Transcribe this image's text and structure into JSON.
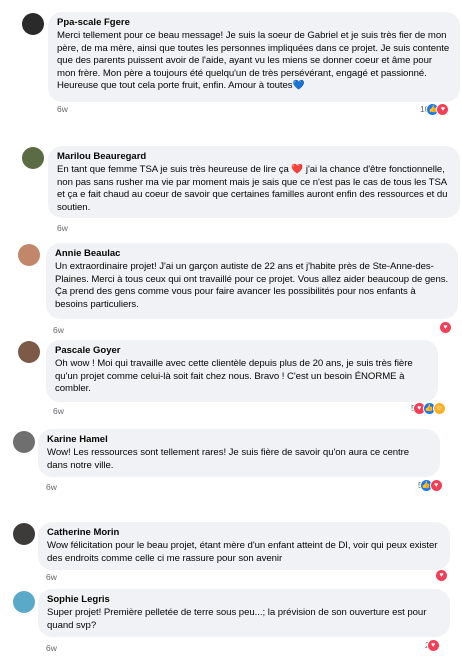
{
  "comments": [
    {
      "author": "Ppa-scale Fgere",
      "text": "Merci tellement pour ce beau message! Je suis la soeur de Gabriel et je suis très fier de mon père, de ma mère, ainsi que toutes les personnes impliquées dans ce projet. Je suis contente que des parents puissent avoir de l'aide, ayant vu les miens se donner coeur et âme pour mon frère. Mon père a toujours été quelqu'un de très persévérant, engagé et passionné. Heureuse que tout cela porte fruit, enfin. Amour à toutes💙",
      "time": "6w",
      "reaction_count": "10",
      "reactions": [
        "like-icon",
        "love-icon"
      ]
    },
    {
      "author": "Marilou Beauregard",
      "text": "En tant que femme TSA je suis très heureuse de lire ça ❤️ j'ai la chance d'être fonctionnelle, non pas sans rusher ma vie par moment mais je sais que ce n'est pas le cas de tous les TSA et ça e fait chaud au coeur de savoir que certaines familles auront enfin des ressources et du soutien.",
      "time": "6w",
      "reaction_count": "",
      "reactions": []
    },
    {
      "author": "Annie Beaulac",
      "text": "Un extraordinaire projet! J'ai un garçon autiste de 22 ans et j'habite près de Ste-Anne-des-Plaines. Merci à tous ceux qui ont travaillé pour ce projet. Vous allez aider beaucoup de gens. Ça prend des gens comme vous pour faire avancer les possibilités pour nos enfants à besoins particuliers.",
      "time": "6w",
      "reaction_count": "",
      "reactions": [
        "love-icon"
      ]
    },
    {
      "author": "Pascale Goyer",
      "text": "Oh wow ! Moi qui travaille avec cette clientèle depuis plus de 20 ans, je suis très fière qu'un projet comme celui-là soit fait chez nous. Bravo ! C'est un besoin ÉNORME à combler.",
      "time": "6w",
      "reaction_count": "5",
      "reactions": [
        "love-icon",
        "like-icon",
        "care-icon"
      ]
    },
    {
      "author": "Karine Hamel",
      "text": "Wow! Les ressources sont tellement rares! Je suis fière de savoir qu'on aura ce centre dans notre ville.",
      "time": "6w",
      "reaction_count": "5",
      "reactions": [
        "like-icon",
        "love-icon"
      ]
    },
    {
      "author": "Catherine Morin",
      "text": "Wow félicitation pour le beau projet, étant mère d'un enfant atteint de DI, voir qui peux exister des endroits comme celle ci me rassure pour son avenir",
      "time": "6w",
      "reaction_count": "",
      "reactions": [
        "love-icon"
      ]
    },
    {
      "author": "Sophie Legris",
      "text": "Super projet! Première pelletée de terre sous peu...; la prévision de son ouverture est pour quand svp?",
      "time": "6w",
      "reaction_count": "2",
      "reactions": [
        "love-icon"
      ]
    }
  ]
}
